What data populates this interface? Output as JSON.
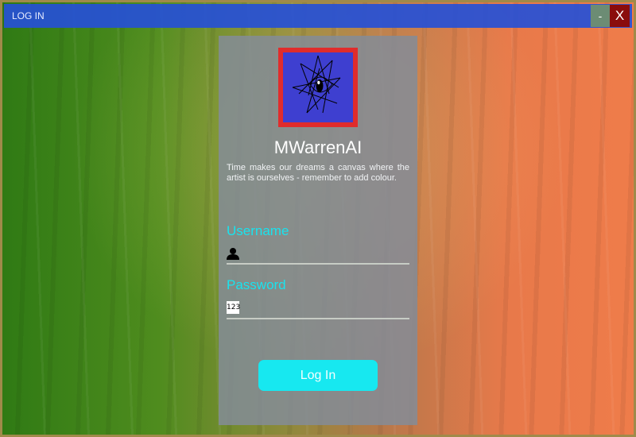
{
  "window": {
    "title": "LOG IN",
    "minimize_label": "-",
    "close_label": "X"
  },
  "brand": {
    "app_name": "MWarrenAI",
    "tagline": "Time makes our dreams a canvas where the artist is ourselves - remember to add colour.",
    "logo_icon": "eye-star-logo-icon"
  },
  "form": {
    "username_label": "Username",
    "username_icon": "user-icon",
    "username_value": "",
    "password_label": "Password",
    "password_icon": "numeric-keypad-icon",
    "password_icon_text": "123",
    "password_value": "",
    "login_label": "Log In"
  },
  "colors": {
    "titlebar": "#2650d6",
    "close_button": "#8a0c0c",
    "minimize_button": "#6c8c74",
    "accent": "#17e8f0",
    "logo_border": "#e02c2c",
    "logo_fill": "#3e3fd0"
  }
}
